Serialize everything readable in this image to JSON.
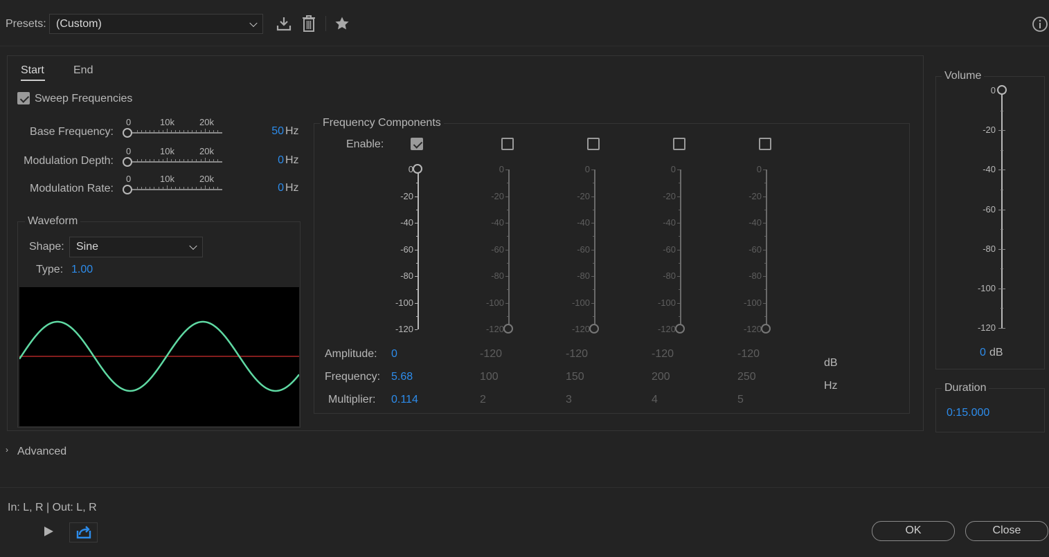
{
  "presets": {
    "label": "Presets:",
    "value": "(Custom)"
  },
  "tabs": [
    {
      "label": "Start"
    },
    {
      "label": "End"
    }
  ],
  "sweep": {
    "label": "Sweep Frequencies",
    "checked": true
  },
  "sliders": [
    {
      "label": "Base Frequency:",
      "value": "50",
      "unit": "Hz"
    },
    {
      "label": "Modulation Depth:",
      "value": "0",
      "unit": "Hz"
    },
    {
      "label": "Modulation Rate:",
      "value": "0",
      "unit": "Hz"
    }
  ],
  "slider_scale": {
    "min": "0",
    "mid": "10k",
    "max": "20k"
  },
  "waveform": {
    "title": "Waveform",
    "shape_label": "Shape:",
    "shape_value": "Sine",
    "type_label": "Type:",
    "type_value": "1.00"
  },
  "freq": {
    "title": "Frequency Components",
    "enable_label": "Enable:",
    "amplitude_label": "Amplitude:",
    "frequency_label": "Frequency:",
    "multiplier_label": "Multiplier:",
    "unit_db": "dB",
    "unit_hz": "Hz",
    "scale": [
      "0",
      "-20",
      "-40",
      "-60",
      "-80",
      "-100",
      "-120"
    ],
    "components": [
      {
        "enabled": true,
        "amplitude": "0",
        "frequency": "5.68",
        "multiplier": "0.114"
      },
      {
        "enabled": false,
        "amplitude": "-120",
        "frequency": "100",
        "multiplier": "2"
      },
      {
        "enabled": false,
        "amplitude": "-120",
        "frequency": "150",
        "multiplier": "3"
      },
      {
        "enabled": false,
        "amplitude": "-120",
        "frequency": "200",
        "multiplier": "4"
      },
      {
        "enabled": false,
        "amplitude": "-120",
        "frequency": "250",
        "multiplier": "5"
      }
    ]
  },
  "volume": {
    "title": "Volume",
    "scale": [
      "0",
      "-20",
      "-40",
      "-60",
      "-80",
      "-100",
      "-120"
    ],
    "value": "0",
    "unit": "dB"
  },
  "duration": {
    "title": "Duration",
    "value": "0:15.000"
  },
  "advanced": {
    "label": "Advanced"
  },
  "io": {
    "label": "In: L, R | Out: L, R"
  },
  "buttons": {
    "ok": "OK",
    "close": "Close"
  },
  "colors": {
    "accent": "#2d8ceb",
    "wave": "#5fd9a3",
    "center_line": "#d32f2f"
  },
  "icons": [
    "chevron-down-icon",
    "download-icon",
    "trash-icon",
    "star-icon",
    "info-icon",
    "play-icon",
    "loop-icon"
  ]
}
